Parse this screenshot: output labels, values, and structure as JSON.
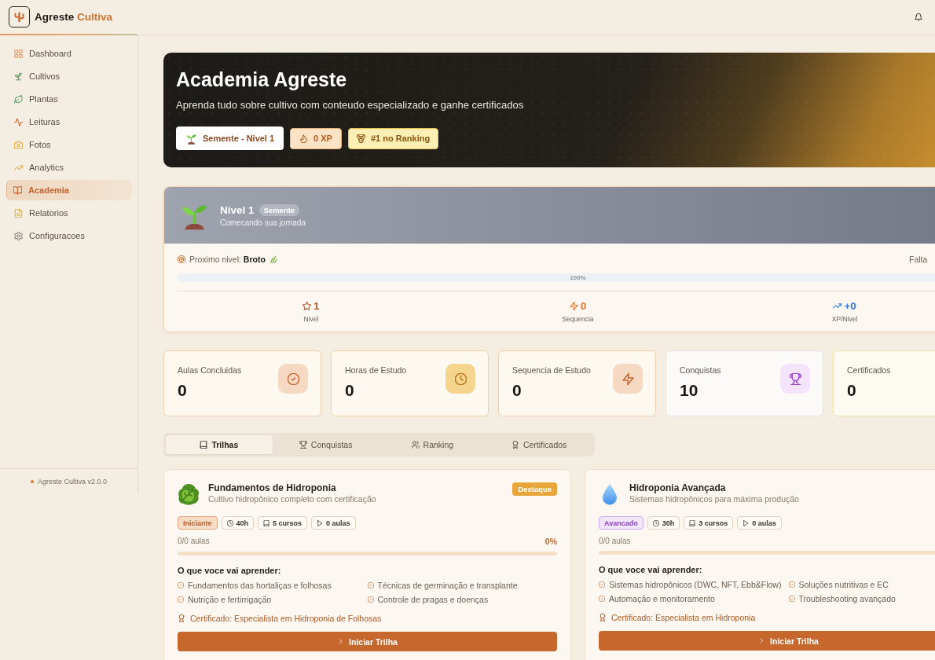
{
  "header": {
    "brand": {
      "name": "Agreste",
      "accent": "Cultiva"
    }
  },
  "sidebar": {
    "items": [
      {
        "label": "Dashboard",
        "selected": false
      },
      {
        "label": "Cultivos",
        "selected": false
      },
      {
        "label": "Plantas",
        "selected": false
      },
      {
        "label": "Leituras",
        "selected": false
      },
      {
        "label": "Fotos",
        "selected": false
      },
      {
        "label": "Analytics",
        "selected": false
      },
      {
        "label": "Academia",
        "selected": true
      },
      {
        "label": "Relatorios",
        "selected": false
      },
      {
        "label": "Configuracoes",
        "selected": false
      }
    ],
    "footer": "Agreste Cultiva v2.0.0"
  },
  "hero": {
    "title": "Academia Agreste",
    "subtitle": "Aprenda tudo sobre cultivo com conteudo especializado e ganhe certificados",
    "badges": [
      {
        "kind": "level",
        "label": "Semente - Nivel 1"
      },
      {
        "kind": "xp",
        "label": "0 XP"
      },
      {
        "kind": "ranking",
        "label": "#1 no Ranking"
      }
    ]
  },
  "level_card": {
    "title": "Nivel 1",
    "tier": "Semente",
    "caption": "Comecando sua jornada",
    "next_level": "Proximo nivel: **Broto**",
    "remaining": "Falta",
    "progress": {
      "level": 1,
      "label": "100%"
    },
    "stats": [
      {
        "value": "1",
        "label": "Nivel"
      },
      {
        "value": "0",
        "label": "Sequencia"
      },
      {
        "value": "+0",
        "label": "XP/Nivel"
      }
    ]
  },
  "stat_cards": [
    {
      "label": "Aulas Concluidas",
      "value": "0",
      "color": "#f5d9c3"
    },
    {
      "label": "Horas de Estudo",
      "value": "0",
      "color": "#f5d48e"
    },
    {
      "label": "Sequencia de Estudo",
      "value": "0",
      "color": "#f5d9c3"
    },
    {
      "label": "Conquistas",
      "value": "10",
      "color": "#f3e3fb"
    },
    {
      "label": "Certificados",
      "value": "0"
    }
  ],
  "tabs": [
    {
      "label": "Trilhas",
      "selected": true
    },
    {
      "label": "Conquistas",
      "selected": false
    },
    {
      "label": "Ranking",
      "selected": false
    },
    {
      "label": "Certificados",
      "selected": false
    }
  ],
  "tracks": [
    {
      "title": "Fundamentos de Hidroponia",
      "subtitle": "Cultivo hidropônico completo com certificação",
      "badge": "Destaque",
      "level_tag": {
        "kind": "beginner",
        "label": "Iniciante"
      },
      "meta": [
        "40h",
        "5 cursos",
        "0 aulas"
      ],
      "progress_text": "0/0 aulas",
      "percent": "0%",
      "progress": {
        "level": 0
      },
      "learn_heading": "O que voce vai aprender:",
      "topics": [
        "Fundamentos das hortaliças e folhosas",
        "Técnicas de germinação e transplante",
        "Nutrição e fertirrigação",
        "Controle de pragas e doenças"
      ],
      "certificate": "Certificado: Especialista em Hidroponia de Folhosas",
      "button": "Iniciar Trilha"
    },
    {
      "title": "Hidroponia Avançada",
      "subtitle": "Sistemas hidropônicos para máxima produção",
      "level_tag": {
        "kind": "advanced",
        "label": "Avancado"
      },
      "meta": [
        "30h",
        "3 cursos",
        "0 aulas"
      ],
      "progress_text": "0/0 aulas",
      "progress": {
        "level": 0
      },
      "learn_heading": "O que voce vai aprender:",
      "topics": [
        "Sistemas hidropônicos (DWC, NFT, Ebb&Flow)",
        "Soluções nutritivas e EC",
        "Automação e monitoramento",
        "Troubleshooting avançado"
      ],
      "certificate": "Certificado: Especialista em Hidroponia",
      "button": "Iniciar Trilha"
    }
  ]
}
